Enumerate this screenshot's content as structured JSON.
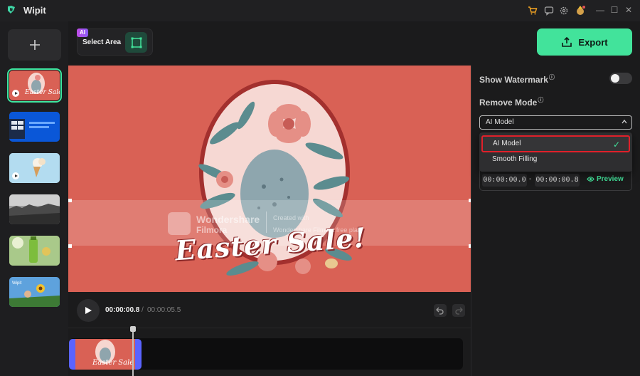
{
  "app": {
    "title": "Wipit"
  },
  "toolbar": {
    "ai_badge": "AI",
    "select_area_label": "Select Area",
    "export_label": "Export"
  },
  "watermark": {
    "brand_line1": "Wondershare",
    "brand_line2": "Filmora",
    "note_line1": "Created with",
    "note_line2": "Wondershare Filmora free plan"
  },
  "preview": {
    "sale_text": "Easter Sale!"
  },
  "player": {
    "current_time": "00:00:00.8",
    "separator": "/",
    "total_time": "00:00:05.5"
  },
  "settings": {
    "show_watermark_label": "Show Watermark",
    "show_watermark_on": false,
    "remove_mode_label": "Remove Mode",
    "remove_mode_selected": "AI Model",
    "remove_mode_options": [
      "AI Model",
      "Smooth Filling"
    ],
    "range_start": "00:00:00.0",
    "range_dash": "-",
    "range_end": "00:00:00.8",
    "preview_label": "Preview"
  },
  "colors": {
    "accent": "#42e39b",
    "preview_bg": "#d96155",
    "highlight_red": "#e0202a",
    "clip_blue": "#5a63ff"
  }
}
